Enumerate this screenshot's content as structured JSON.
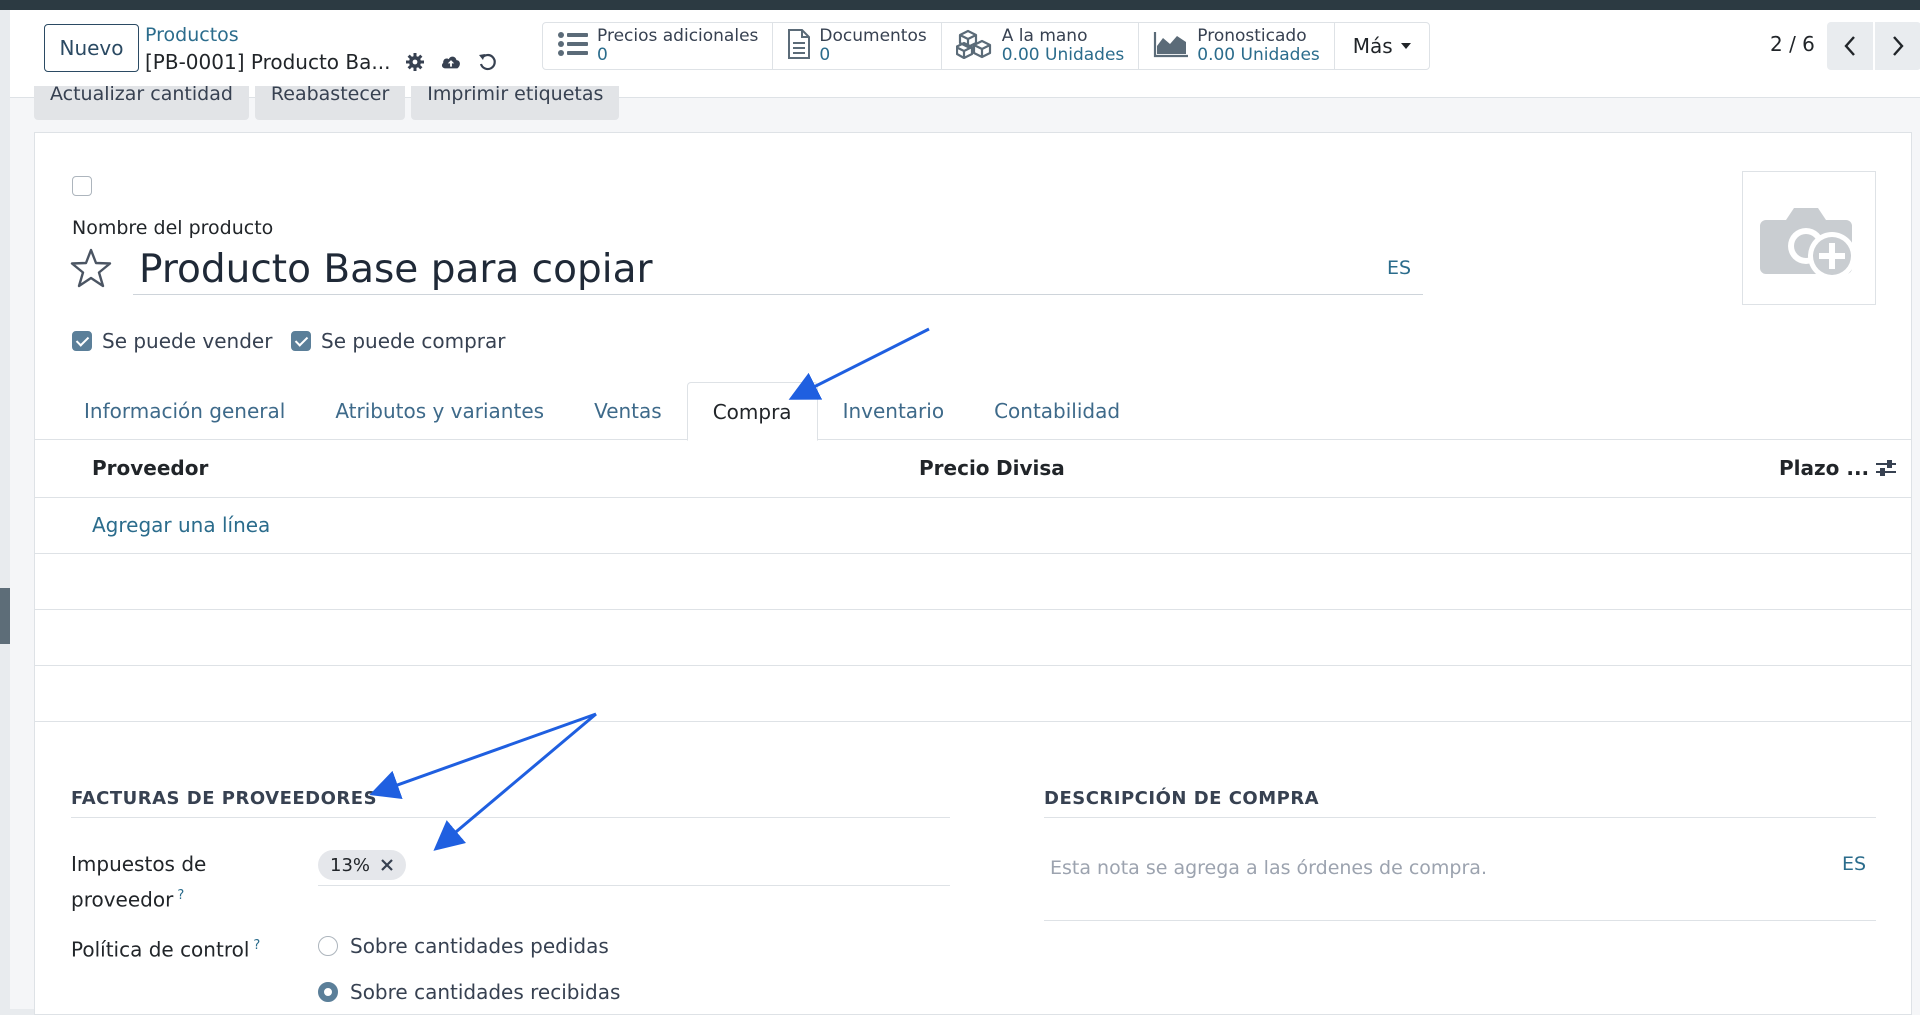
{
  "control_panel": {
    "new_button": "Nuevo",
    "breadcrumb_parent": "Productos",
    "breadcrumb_current": "[PB-0001] Producto Ba...",
    "smart_buttons": [
      {
        "label": "Precios adicionales",
        "value": "0",
        "icon": "list-icon"
      },
      {
        "label": "Documentos",
        "value": "0",
        "icon": "document-icon"
      },
      {
        "label": "A la mano",
        "value": "0.00 Unidades",
        "icon": "cubes-icon"
      },
      {
        "label": "Pronosticado",
        "value": "0.00 Unidades",
        "icon": "area-chart-icon"
      }
    ],
    "more_button": "Más",
    "pager": "2 / 6"
  },
  "status_buttons": [
    "Actualizar cantidad",
    "Reabastecer",
    "Imprimir etiquetas"
  ],
  "form": {
    "name_label": "Nombre del producto",
    "name_value": "Producto Base para copiar",
    "lang": "ES",
    "can_sell_label": "Se puede vender",
    "can_purchase_label": "Se puede comprar",
    "can_sell": true,
    "can_purchase": true
  },
  "tabs": [
    {
      "label": "Información general",
      "active": false
    },
    {
      "label": "Atributos y variantes",
      "active": false
    },
    {
      "label": "Ventas",
      "active": false
    },
    {
      "label": "Compra",
      "active": true
    },
    {
      "label": "Inventario",
      "active": false
    },
    {
      "label": "Contabilidad",
      "active": false
    }
  ],
  "vendor_list": {
    "columns": [
      "Proveedor",
      "Precio",
      "Divisa",
      "Plazo ..."
    ],
    "add_line": "Agregar una línea"
  },
  "vendor_bills": {
    "title": "FACTURAS DE PROVEEDORES",
    "taxes_label_line1": "Impuestos de",
    "taxes_label_line2": "proveedor",
    "help": "?",
    "tax_tag": "13%",
    "control_policy_label": "Política de control",
    "options": [
      {
        "label": "Sobre cantidades pedidas",
        "selected": false
      },
      {
        "label": "Sobre cantidades recibidas",
        "selected": true
      }
    ]
  },
  "purchase_description": {
    "title": "DESCRIPCIÓN DE COMPRA",
    "placeholder": "Esta nota se agrega a las órdenes de compra.",
    "lang": "ES"
  },
  "colors": {
    "link": "#2b6c8c",
    "arrow": "#1f5fe0",
    "checkbox": "#5b7f99"
  }
}
